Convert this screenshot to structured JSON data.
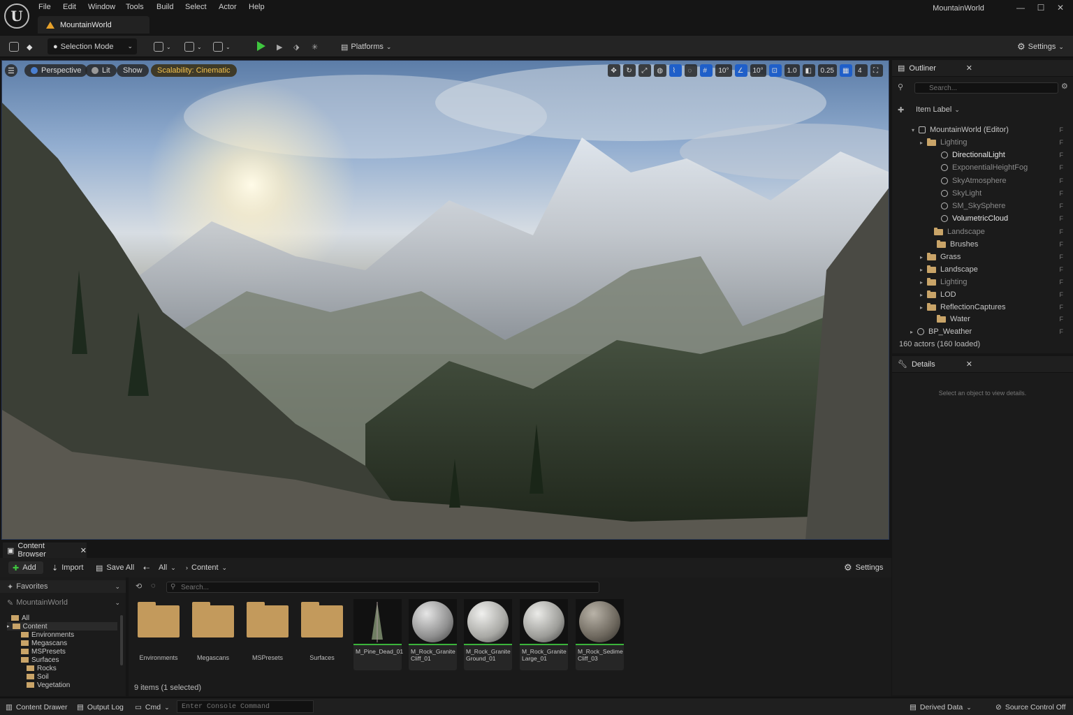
{
  "menu": [
    "File",
    "Edit",
    "Window",
    "Tools",
    "Build",
    "Select",
    "Actor",
    "Help"
  ],
  "document_tab": "MountainWorld",
  "window_title": "MountainWorld",
  "window_controls": {
    "minimize": "—",
    "maximize": "☐",
    "close": "✕"
  },
  "toolbar": {
    "selection_mode": "Selection Mode",
    "platforms": "Platforms",
    "settings": "Settings"
  },
  "viewport": {
    "perspective": "Perspective",
    "lit": "Lit",
    "show": "Show",
    "scalability": "Scalability: Cinematic",
    "tools": [
      "10°",
      "10°",
      "1.0",
      "0.25",
      "4"
    ]
  },
  "outliner": {
    "title": "Outliner",
    "search_placeholder": "Search...",
    "column": "Item Label",
    "items": [
      {
        "label": "MountainWorld (Editor)"
      },
      {
        "label": "Lighting"
      },
      {
        "label": "DirectionalLight"
      },
      {
        "label": "ExponentialHeightFog"
      },
      {
        "label": "SkyAtmosphere"
      },
      {
        "label": "SkyLight"
      },
      {
        "label": "SM_SkySphere"
      },
      {
        "label": "VolumetricCloud"
      },
      {
        "label": "Landscape"
      },
      {
        "label": "Brushes"
      },
      {
        "label": "Grass"
      },
      {
        "label": "Landscape"
      },
      {
        "label": "Lighting"
      },
      {
        "label": "LOD"
      },
      {
        "label": "ReflectionCaptures"
      },
      {
        "label": "Water"
      },
      {
        "label": "BP_Weather"
      }
    ],
    "actor_count": "160 actors (160 loaded)"
  },
  "details": {
    "title": "Details",
    "empty_message": "Select an object to view details."
  },
  "content_browser": {
    "title": "Content Browser",
    "add": "Add",
    "import": "Import",
    "save_all": "Save All",
    "all": "All",
    "path": "Content",
    "settings": "Settings",
    "search_placeholder": "Search...",
    "favorites": "Favorites",
    "project": "MountainWorld",
    "tree": [
      "All",
      "Content",
      "Environments",
      "Megascans",
      "MSPresets",
      "Surfaces",
      "Rocks",
      "Soil",
      "Vegetation"
    ],
    "folders": [
      "Environments",
      "Megascans",
      "MSPresets",
      "Surfaces"
    ],
    "assets": [
      {
        "line1": "M_Pine_Dead_01",
        "line2": ""
      },
      {
        "line1": "M_Rock_Granite",
        "line2": "Cliff_01"
      },
      {
        "line1": "M_Rock_Granite",
        "line2": "Ground_01"
      },
      {
        "line1": "M_Rock_Granite",
        "line2": "Large_01"
      },
      {
        "line1": "M_Rock_Sedime",
        "line2": "Cliff_03"
      }
    ],
    "item_count": "9 items (1 selected)"
  },
  "statusbar": {
    "content_drawer": "Content Drawer",
    "output_log": "Output Log",
    "cmd": "Cmd",
    "console_placeholder": "Enter Console Command",
    "derived_data": "Derived Data",
    "source_control": "Source Control Off"
  },
  "colors": {
    "accent": "#1f5fc9",
    "play": "#3fc63f",
    "warning": "#e7a12a",
    "scalability": "#f3c24e",
    "folder": "#c39a5c"
  }
}
